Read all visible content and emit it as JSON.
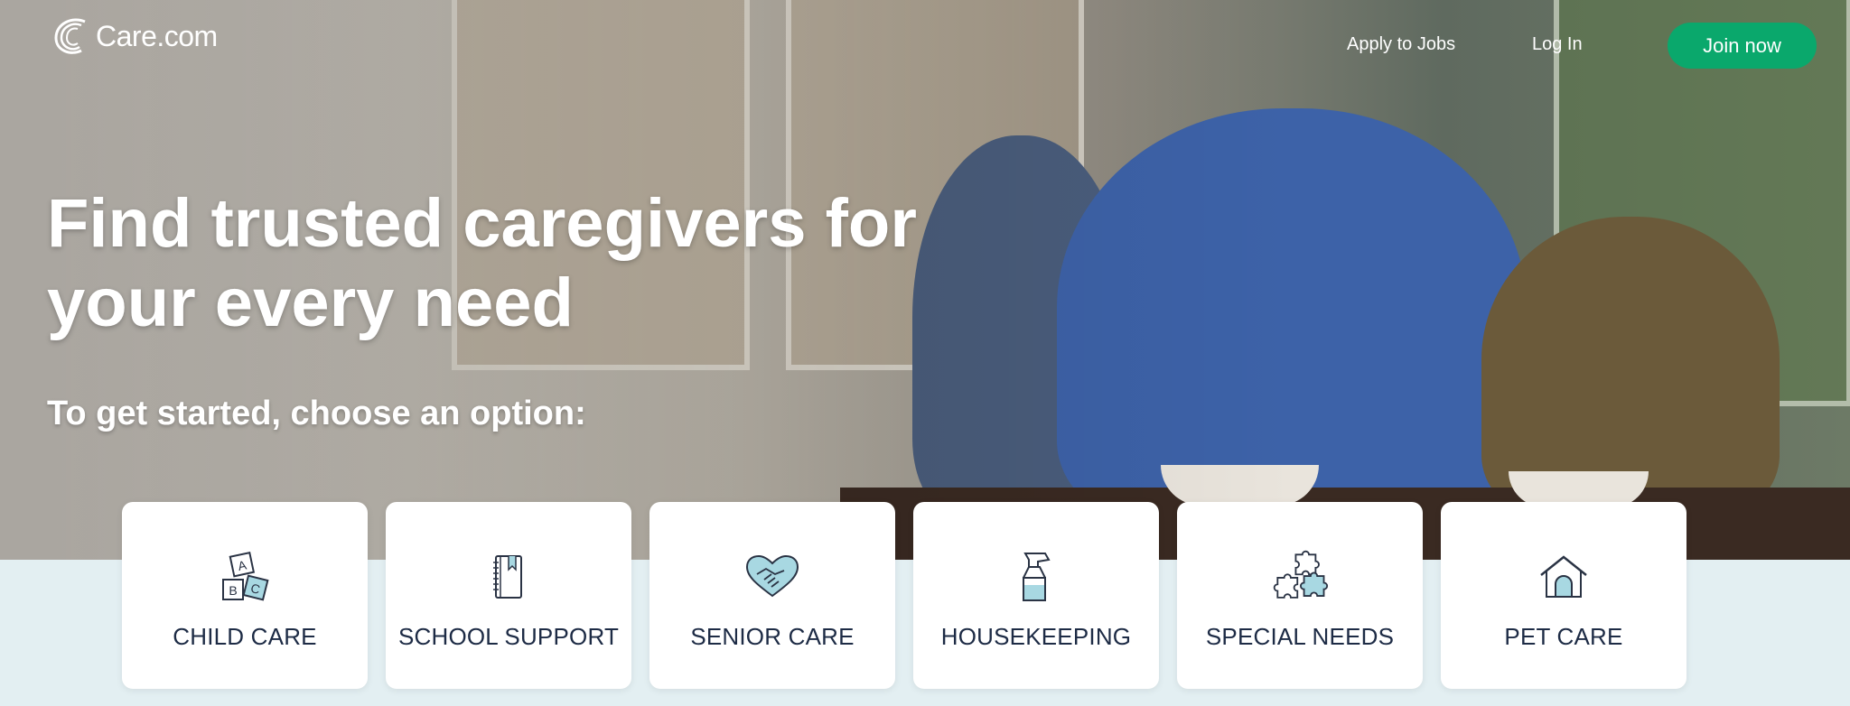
{
  "header": {
    "logo_text": "Care.com",
    "apply_label": "Apply to Jobs",
    "login_label": "Log In",
    "join_label": "Join now"
  },
  "hero": {
    "headline_line1": "Find trusted caregivers for",
    "headline_line2": "your every need",
    "subhead": "To get started, choose an option:"
  },
  "categories": [
    {
      "label": "CHILD CARE",
      "icon": "abc-blocks-icon"
    },
    {
      "label": "SCHOOL SUPPORT",
      "icon": "notebook-icon"
    },
    {
      "label": "SENIOR CARE",
      "icon": "heart-handshake-icon"
    },
    {
      "label": "HOUSEKEEPING",
      "icon": "spray-bottle-icon"
    },
    {
      "label": "SPECIAL NEEDS",
      "icon": "puzzle-icon"
    },
    {
      "label": "PET CARE",
      "icon": "doghouse-icon"
    }
  ],
  "colors": {
    "brand_green": "#0aa86c",
    "label_text": "#1d2b45",
    "icon_accent": "#a8d8e2",
    "page_bg": "#e3eff2"
  }
}
